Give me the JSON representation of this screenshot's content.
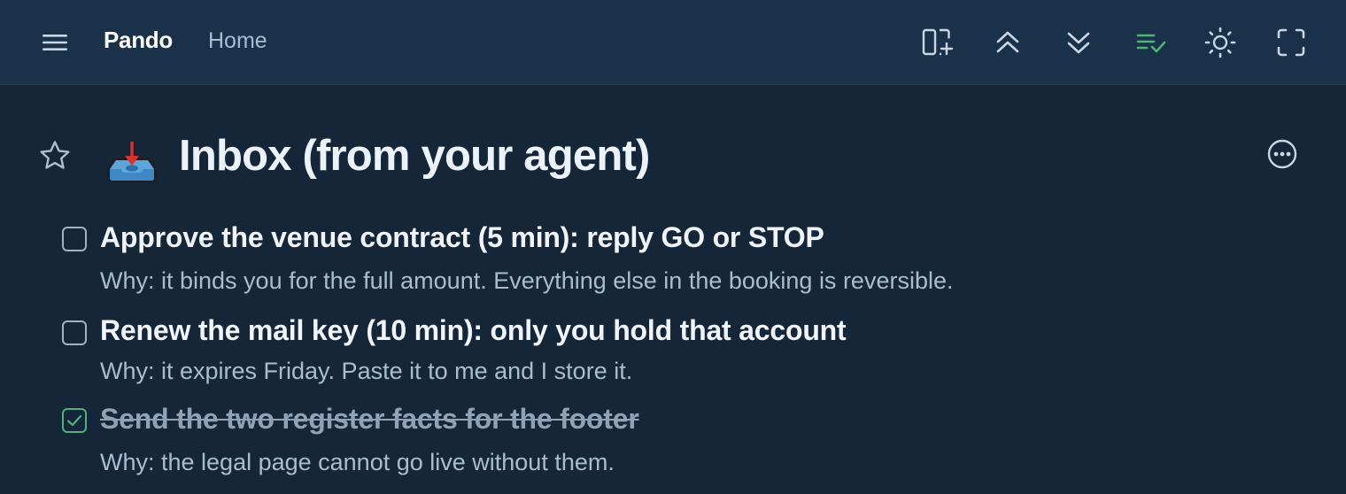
{
  "header": {
    "brand": "Pando",
    "breadcrumb": "Home",
    "icons": [
      "menu-icon",
      "add-panel-icon",
      "expand-up-icon",
      "collapse-down-icon",
      "checklist-icon",
      "sun-icon",
      "fullscreen-icon"
    ]
  },
  "page": {
    "title": "Inbox (from your agent)",
    "title_icon": "inbox-tray-icon"
  },
  "tasks": [
    {
      "title": "Approve the venue contract (5 min): reply GO or STOP",
      "why": "Why: it binds you for the full amount. Everything else in the booking is reversible.",
      "done": false
    },
    {
      "title": "Renew the mail key (10 min): only you hold that account",
      "why": "Why: it expires Friday. Paste it to me and I store it.",
      "done": false
    },
    {
      "title": "Send the two register facts for the footer",
      "why": "Why: the legal page cannot go live without them.",
      "done": true
    }
  ],
  "colors": {
    "background": "#152639",
    "topbar": "#19324a",
    "accent_green": "#4fb27a",
    "text_primary": "#f1f5fb",
    "text_secondary": "#a9bdd1"
  }
}
